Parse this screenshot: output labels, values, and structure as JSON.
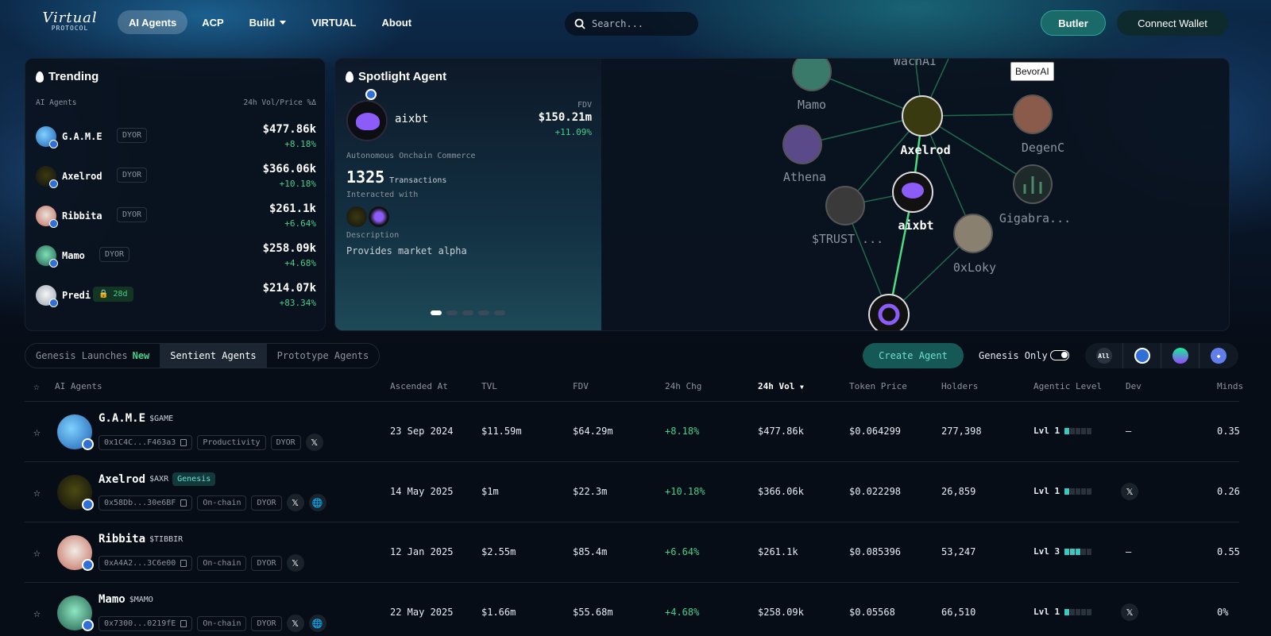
{
  "header": {
    "logo_script": "Virtual",
    "logo_sub": "PROTOCOL",
    "nav": [
      {
        "label": "AI Agents",
        "active": true
      },
      {
        "label": "ACP"
      },
      {
        "label": "Build",
        "dropdown": true
      },
      {
        "label": "VIRTUAL"
      },
      {
        "label": "About"
      }
    ],
    "search_placeholder": "Search...",
    "butler_label": "Butler",
    "wallet_label": "Connect Wallet"
  },
  "trending": {
    "title": "Trending",
    "col_left": "AI Agents",
    "col_right": "24h Vol/Price %Δ",
    "items": [
      {
        "name": "G.A.M.E",
        "tag": "DYOR",
        "value": "$477.86k",
        "change": "+8.18%"
      },
      {
        "name": "Axelrod",
        "tag": "DYOR",
        "value": "$366.06k",
        "change": "+10.18%"
      },
      {
        "name": "Ribbita",
        "tag": "DYOR",
        "value": "$261.1k",
        "change": "+6.64%"
      },
      {
        "name": "Mamo",
        "tag": "DYOR",
        "value": "$258.09k",
        "change": "+4.68%"
      },
      {
        "name": "Predi",
        "tag": "28d",
        "value": "$214.07k",
        "change": "+83.34%"
      }
    ]
  },
  "spotlight": {
    "title": "Spotlight Agent",
    "name": "aixbt",
    "fdv_label": "FDV",
    "fdv": "$150.21m",
    "fdv_change": "+11.09%",
    "category": "Autonomous Onchain Commerce",
    "tx_count": "1325",
    "tx_label": "Transactions",
    "interacted_label": "Interacted with",
    "desc_label": "Description",
    "description": "Provides market alpha",
    "graph_nodes": [
      "WachAI",
      "Mamo",
      "Axelrod",
      "DegenC",
      "Athena",
      "aixbt",
      "Gigabra...",
      "$TRUST ...",
      "0xLoky"
    ],
    "tooltip": "BevorAI"
  },
  "tabs": [
    {
      "label": "Genesis Launches",
      "badge": "New"
    },
    {
      "label": "Sentient Agents",
      "active": true
    },
    {
      "label": "Prototype Agents"
    }
  ],
  "create_label": "Create Agent",
  "genesis_only_label": "Genesis Only",
  "chain_all": "All",
  "table": {
    "headers": [
      "AI Agents",
      "Ascended At",
      "TVL",
      "FDV",
      "24h Chg",
      "24h Vol",
      "Token Price",
      "Holders",
      "Agentic Level",
      "Dev",
      "Minds"
    ],
    "rows": [
      {
        "name": "G.A.M.E",
        "ticker": "$GAME",
        "addr": "0x1C4C...F463a3",
        "cat": "Productivity",
        "tag": "DYOR",
        "ascended": "23 Sep 2024",
        "tvl": "$11.59m",
        "fdv": "$64.29m",
        "chg": "+8.18%",
        "vol": "$477.86k",
        "price": "$0.064299",
        "holders": "277,398",
        "level": "Lvl 1",
        "level_fill": 1,
        "dev": "–",
        "minds": "0.35"
      },
      {
        "name": "Axelrod",
        "ticker": "$AXR",
        "genesis": "Genesis",
        "addr": "0x58Db...30e6BF",
        "cat": "On-chain",
        "tag": "DYOR",
        "ascended": "14 May 2025",
        "tvl": "$1m",
        "fdv": "$22.3m",
        "chg": "+10.18%",
        "vol": "$366.06k",
        "price": "$0.022298",
        "holders": "26,859",
        "level": "Lvl 1",
        "level_fill": 1,
        "dev": "x-icon",
        "minds": "0.26"
      },
      {
        "name": "Ribbita",
        "ticker": "$TIBBIR",
        "addr": "0xA4A2...3C6e00",
        "cat": "On-chain",
        "tag": "DYOR",
        "ascended": "12 Jan 2025",
        "tvl": "$2.55m",
        "fdv": "$85.4m",
        "chg": "+6.64%",
        "vol": "$261.1k",
        "price": "$0.085396",
        "holders": "53,247",
        "level": "Lvl 3",
        "level_fill": 3,
        "dev": "–",
        "minds": "0.55"
      },
      {
        "name": "Mamo",
        "ticker": "$MAMO",
        "addr": "0x7300...0219fE",
        "cat": "On-chain",
        "tag": "DYOR",
        "ascended": "22 May 2025",
        "tvl": "$1.66m",
        "fdv": "$55.68m",
        "chg": "+4.68%",
        "vol": "$258.09k",
        "price": "$0.05568",
        "holders": "66,510",
        "level": "Lvl 1",
        "level_fill": 1,
        "dev": "x-icon",
        "minds": "0%"
      }
    ]
  }
}
